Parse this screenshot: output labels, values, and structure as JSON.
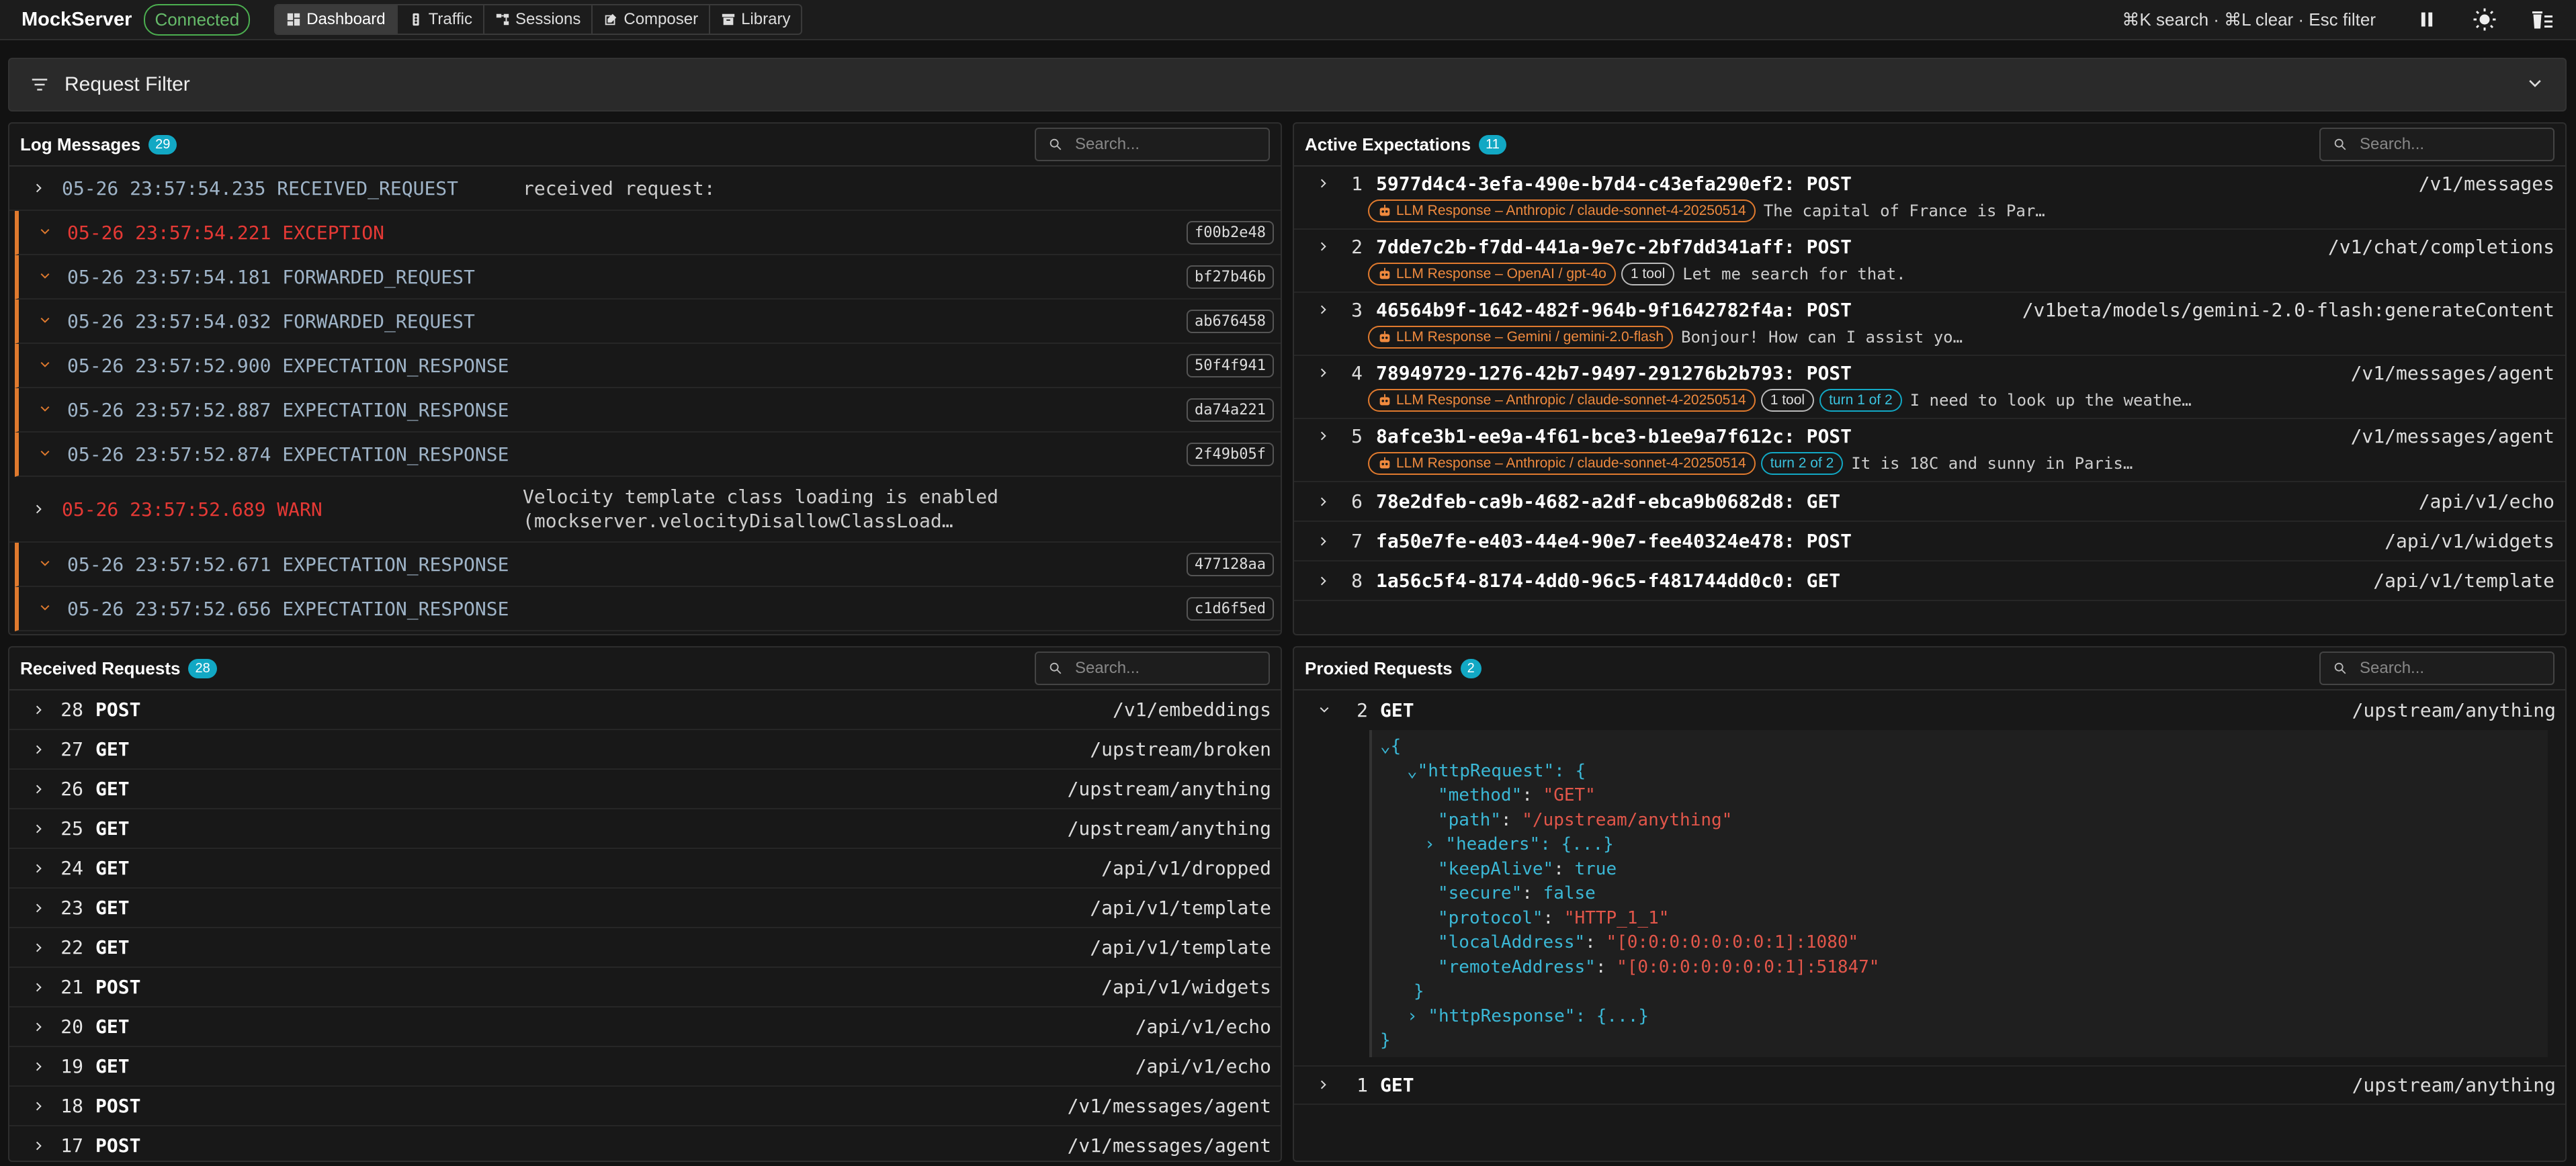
{
  "app": {
    "name": "MockServer",
    "status": "Connected"
  },
  "nav": [
    {
      "label": "Dashboard",
      "icon": "dashboard-icon",
      "active": true
    },
    {
      "label": "Traffic",
      "icon": "traffic-icon"
    },
    {
      "label": "Sessions",
      "icon": "sessions-icon"
    },
    {
      "label": "Composer",
      "icon": "composer-icon"
    },
    {
      "label": "Library",
      "icon": "library-icon"
    }
  ],
  "shortcuts": "⌘K search · ⌘L clear · Esc filter",
  "filter": {
    "title": "Request Filter"
  },
  "log": {
    "title": "Log Messages",
    "count": "29",
    "search_placeholder": "Search...",
    "rows": [
      {
        "time": "05-26 23:57:54.235",
        "type": "RECEIVED_REQUEST",
        "message": "received request:"
      },
      {
        "time": "05-26 23:57:54.221",
        "type": "EXCEPTION",
        "hash": "f00b2e48"
      },
      {
        "time": "05-26 23:57:54.181",
        "type": "FORWARDED_REQUEST",
        "hash": "bf27b46b"
      },
      {
        "time": "05-26 23:57:54.032",
        "type": "FORWARDED_REQUEST",
        "hash": "ab676458"
      },
      {
        "time": "05-26 23:57:52.900",
        "type": "EXPECTATION_RESPONSE",
        "hash": "50f4f941"
      },
      {
        "time": "05-26 23:57:52.887",
        "type": "EXPECTATION_RESPONSE",
        "hash": "da74a221"
      },
      {
        "time": "05-26 23:57:52.874",
        "type": "EXPECTATION_RESPONSE",
        "hash": "2f49b05f"
      },
      {
        "time": "05-26 23:57:52.689",
        "type": "WARN",
        "message1": "Velocity template class loading is enabled",
        "message2": "(mockserver.velocityDisallowClassLoad…"
      },
      {
        "time": "05-26 23:57:52.671",
        "type": "EXPECTATION_RESPONSE",
        "hash": "477128aa"
      },
      {
        "time": "05-26 23:57:52.656",
        "type": "EXPECTATION_RESPONSE",
        "hash": "c1d6f5ed"
      }
    ]
  },
  "expectations": {
    "title": "Active Expectations",
    "count": "11",
    "search_placeholder": "Search...",
    "rows": [
      {
        "num": "1",
        "id": "5977d4c4-3efa-490e-b7d4-c43efa290ef2:",
        "method": "POST",
        "path": "/v1/messages",
        "tag": "LLM Response – Anthropic / claude-sonnet-4-20250514",
        "preview": "The capital of France is Par…"
      },
      {
        "num": "2",
        "id": "7dde7c2b-f7dd-441a-9e7c-2bf7dd341aff:",
        "method": "POST",
        "path": "/v1/chat/completions",
        "tag": "LLM Response – OpenAI / gpt-4o",
        "tool": "1 tool",
        "preview": "Let me search for that."
      },
      {
        "num": "3",
        "id": "46564b9f-1642-482f-964b-9f1642782f4a:",
        "method": "POST",
        "path": "/v1beta/models/gemini-2.0-flash:generateContent",
        "tag": "LLM Response – Gemini / gemini-2.0-flash",
        "preview": "Bonjour! How can I assist yo…"
      },
      {
        "num": "4",
        "id": "78949729-1276-42b7-9497-291276b2b793:",
        "method": "POST",
        "path": "/v1/messages/agent",
        "tag": "LLM Response – Anthropic / claude-sonnet-4-20250514",
        "tool": "1 tool",
        "turn": "turn 1 of 2",
        "preview": "I need to look up the weathe…"
      },
      {
        "num": "5",
        "id": "8afce3b1-ee9a-4f61-bce3-b1ee9a7f612c:",
        "method": "POST",
        "path": "/v1/messages/agent",
        "tag": "LLM Response – Anthropic / claude-sonnet-4-20250514",
        "turn": "turn 2 of 2",
        "preview": "It is 18C and sunny in Paris…"
      },
      {
        "num": "6",
        "id": "78e2dfeb-ca9b-4682-a2df-ebca9b0682d8:",
        "method": "GET",
        "path": "/api/v1/echo"
      },
      {
        "num": "7",
        "id": "fa50e7fe-e403-44e4-90e7-fee40324e478:",
        "method": "POST",
        "path": "/api/v1/widgets"
      },
      {
        "num": "8",
        "id": "1a56c5f4-8174-4dd0-96c5-f481744dd0c0:",
        "method": "GET",
        "path": "/api/v1/template"
      }
    ]
  },
  "received": {
    "title": "Received Requests",
    "count": "28",
    "search_placeholder": "Search...",
    "rows": [
      {
        "num": "28",
        "method": "POST",
        "path": "/v1/embeddings"
      },
      {
        "num": "27",
        "method": "GET",
        "path": "/upstream/broken"
      },
      {
        "num": "26",
        "method": "GET",
        "path": "/upstream/anything"
      },
      {
        "num": "25",
        "method": "GET",
        "path": "/upstream/anything"
      },
      {
        "num": "24",
        "method": "GET",
        "path": "/api/v1/dropped"
      },
      {
        "num": "23",
        "method": "GET",
        "path": "/api/v1/template"
      },
      {
        "num": "22",
        "method": "GET",
        "path": "/api/v1/template"
      },
      {
        "num": "21",
        "method": "POST",
        "path": "/api/v1/widgets"
      },
      {
        "num": "20",
        "method": "GET",
        "path": "/api/v1/echo"
      },
      {
        "num": "19",
        "method": "GET",
        "path": "/api/v1/echo"
      },
      {
        "num": "18",
        "method": "POST",
        "path": "/v1/messages/agent"
      },
      {
        "num": "17",
        "method": "POST",
        "path": "/v1/messages/agent"
      }
    ]
  },
  "proxied": {
    "title": "Proxied Requests",
    "count": "2",
    "search_placeholder": "Search...",
    "rows": [
      {
        "num": "2",
        "method": "GET",
        "path": "/upstream/anything"
      },
      {
        "num": "1",
        "method": "GET",
        "path": "/upstream/anything"
      }
    ],
    "json": {
      "open": "{",
      "httpRequest_key": "\"httpRequest\"",
      "colon_open": ": {",
      "method_key": "\"method\"",
      "method_val": "\"GET\"",
      "path_key": "\"path\"",
      "path_val": "\"/upstream/anything\"",
      "headers_key": "\"headers\"",
      "headers_val": ": {...}",
      "keepAlive_key": "\"keepAlive\"",
      "keepAlive_val": "true",
      "secure_key": "\"secure\"",
      "secure_val": "false",
      "protocol_key": "\"protocol\"",
      "protocol_val": "\"HTTP_1_1\"",
      "localAddress_key": "\"localAddress\"",
      "localAddress_val": "\"[0:0:0:0:0:0:0:1]:1080\"",
      "remoteAddress_key": "\"remoteAddress\"",
      "remoteAddress_val": "\"[0:0:0:0:0:0:0:1]:51847\"",
      "close_inner": "}",
      "httpResponse_key": "\"httpResponse\"",
      "httpResponse_val": ": {...}",
      "close": "}"
    }
  }
}
